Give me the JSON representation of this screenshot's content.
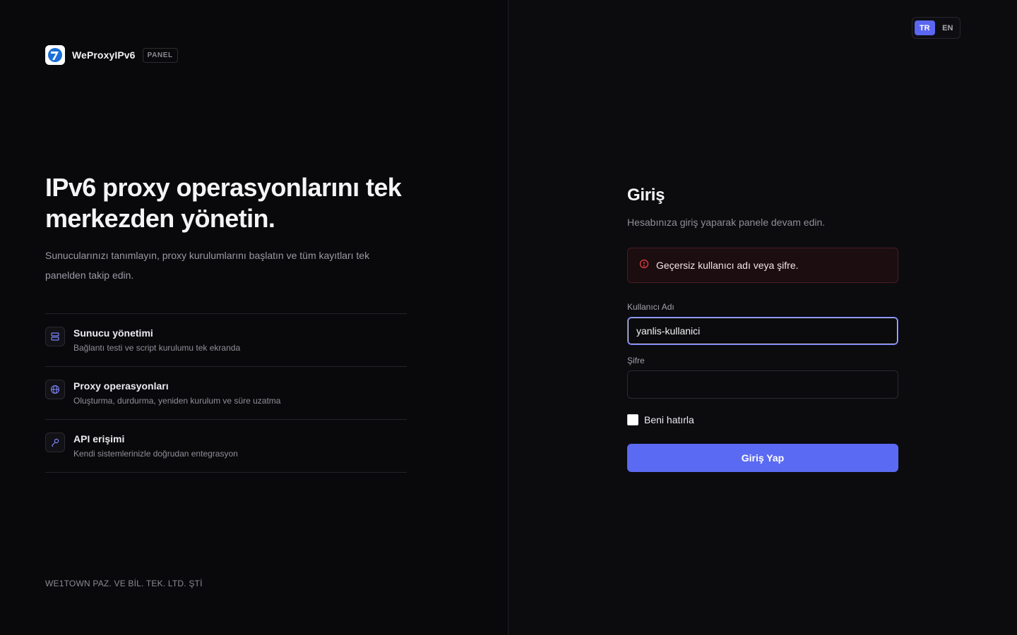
{
  "brand": {
    "name": "WeProxyIPv6",
    "tag": "PANEL",
    "logo_icon": "brand-logo-icon"
  },
  "hero": {
    "title": "IPv6 proxy operasyonlarını tek merkezden yönetin.",
    "description": "Sunucularınızı tanımlayın, proxy kurulumlarını başlatın ve tüm kayıtları tek panelden takip edin."
  },
  "features": [
    {
      "icon": "server-icon",
      "title": "Sunucu yönetimi",
      "subtitle": "Bağlantı testi ve script kurulumu tek ekranda"
    },
    {
      "icon": "globe-icon",
      "title": "Proxy operasyonları",
      "subtitle": "Oluşturma, durdurma, yeniden kurulum ve süre uzatma"
    },
    {
      "icon": "key-icon",
      "title": "API erişimi",
      "subtitle": "Kendi sistemlerinizle doğrudan entegrasyon"
    }
  ],
  "footer": {
    "company": "WE1TOWN PAZ. VE BİL. TEK. LTD. ŞTİ"
  },
  "language": {
    "options": [
      "TR",
      "EN"
    ],
    "selected": "TR"
  },
  "login": {
    "title": "Giriş",
    "subtitle": "Hesabınıza giriş yaparak panele devam edin.",
    "error": "Geçersiz kullanıcı adı veya şifre.",
    "username_label": "Kullanıcı Adı",
    "username_value": "yanlis-kullanici",
    "password_label": "Şifre",
    "password_value": "",
    "remember_label": "Beni hatırla",
    "submit_label": "Giriş Yap"
  },
  "colors": {
    "accent": "#5b6af2",
    "error_border": "#4a1d23",
    "error_icon": "#ef4444"
  }
}
